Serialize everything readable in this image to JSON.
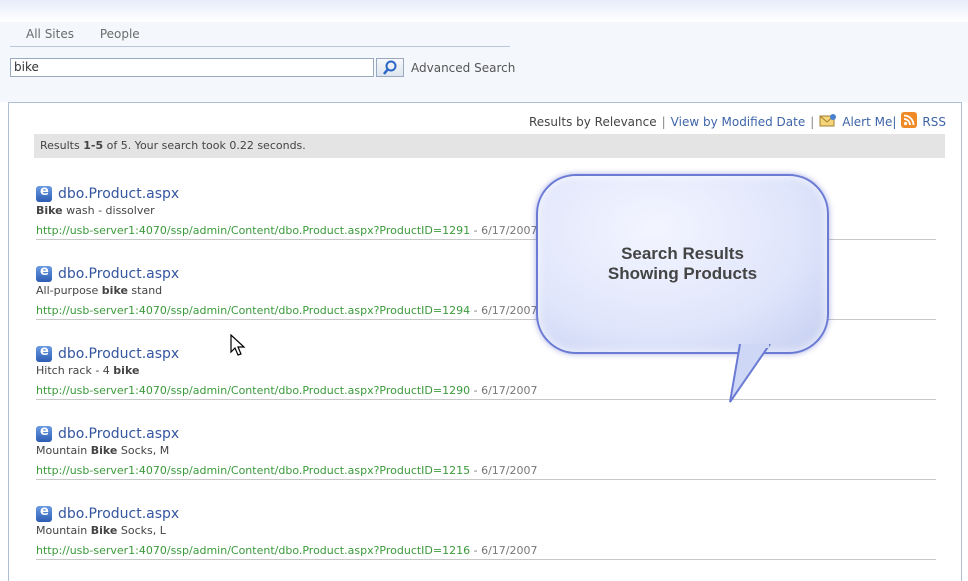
{
  "scope_tabs": [
    "All Sites",
    "People"
  ],
  "search": {
    "value": "bike",
    "advanced_label": "Advanced Search"
  },
  "toolbar": {
    "relevance": "Results by Relevance",
    "sep1": "|",
    "modified": "View by Modified Date",
    "sep2": "|",
    "alert": "Alert Me|",
    "rss": "RSS"
  },
  "status": {
    "prefix": "Results ",
    "range": "1-5",
    "mid": " of 5. Your search took 0.22 seconds."
  },
  "results": [
    {
      "title": "dbo.Product.aspx",
      "desc_bold": "Bike",
      "desc_rest": " wash - dissolver",
      "url": "http://usb-server1:4070/ssp/admin/Content/dbo.Product.aspx?ProductID=1291",
      "date": " - 6/17/2007"
    },
    {
      "title": "dbo.Product.aspx",
      "desc_pre": "All-purpose ",
      "desc_bold": "bike",
      "desc_rest": " stand",
      "url": "http://usb-server1:4070/ssp/admin/Content/dbo.Product.aspx?ProductID=1294",
      "date": " - 6/17/2007"
    },
    {
      "title": "dbo.Product.aspx",
      "desc_pre": "Hitch rack - 4 ",
      "desc_bold": "bike",
      "desc_rest": "",
      "url": "http://usb-server1:4070/ssp/admin/Content/dbo.Product.aspx?ProductID=1290",
      "date": " - 6/17/2007"
    },
    {
      "title": "dbo.Product.aspx",
      "desc_pre": "Mountain ",
      "desc_bold": "Bike",
      "desc_rest": " Socks, M",
      "url": "http://usb-server1:4070/ssp/admin/Content/dbo.Product.aspx?ProductID=1215",
      "date": " - 6/17/2007"
    },
    {
      "title": "dbo.Product.aspx",
      "desc_pre": "Mountain ",
      "desc_bold": "Bike",
      "desc_rest": " Socks, L",
      "url": "http://usb-server1:4070/ssp/admin/Content/dbo.Product.aspx?ProductID=1216",
      "date": " - 6/17/2007"
    }
  ],
  "callout": {
    "line1": "Search Results",
    "line2": "Showing Products"
  },
  "icons": {
    "search": "search-icon",
    "result": "document-icon",
    "alert": "alert-icon",
    "rss": "rss-icon"
  },
  "colors": {
    "link": "#3e64a8",
    "url": "#3b9b3b",
    "callout_border": "#6b7bd4"
  }
}
